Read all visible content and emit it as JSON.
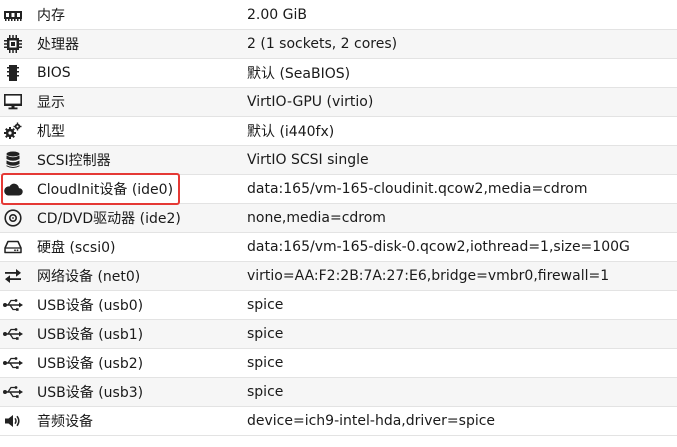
{
  "hardware": {
    "rows": [
      {
        "icon": "memory-icon",
        "name": "内存",
        "value": "2.00 GiB"
      },
      {
        "icon": "cpu-icon",
        "name": "处理器",
        "value": "2 (1 sockets, 2 cores)"
      },
      {
        "icon": "bios-chip-icon",
        "name": "BIOS",
        "value": "默认 (SeaBIOS)"
      },
      {
        "icon": "monitor-icon",
        "name": "显示",
        "value": "VirtIO-GPU (virtio)"
      },
      {
        "icon": "gears-icon",
        "name": "机型",
        "value": "默认 (i440fx)"
      },
      {
        "icon": "database-icon",
        "name": "SCSI控制器",
        "value": "VirtIO SCSI single"
      },
      {
        "icon": "cloud-icon",
        "name": "CloudInit设备 (ide0)",
        "value": "data:165/vm-165-cloudinit.qcow2,media=cdrom"
      },
      {
        "icon": "cdrom-icon",
        "name": "CD/DVD驱动器 (ide2)",
        "value": "none,media=cdrom"
      },
      {
        "icon": "hdd-icon",
        "name": "硬盘 (scsi0)",
        "value": "data:165/vm-165-disk-0.qcow2,iothread=1,size=100G"
      },
      {
        "icon": "exchange-icon",
        "name": "网络设备 (net0)",
        "value": "virtio=AA:F2:2B:7A:27:E6,bridge=vmbr0,firewall=1"
      },
      {
        "icon": "usb-icon",
        "name": "USB设备 (usb0)",
        "value": "spice"
      },
      {
        "icon": "usb-icon",
        "name": "USB设备 (usb1)",
        "value": "spice"
      },
      {
        "icon": "usb-icon",
        "name": "USB设备 (usb2)",
        "value": "spice"
      },
      {
        "icon": "usb-icon",
        "name": "USB设备 (usb3)",
        "value": "spice"
      },
      {
        "icon": "speaker-icon",
        "name": "音频设备",
        "value": "device=ich9-intel-hda,driver=spice"
      }
    ],
    "highlighted_row": "CloudInit设备 (ide0)",
    "highlight_color": "#e53935"
  }
}
